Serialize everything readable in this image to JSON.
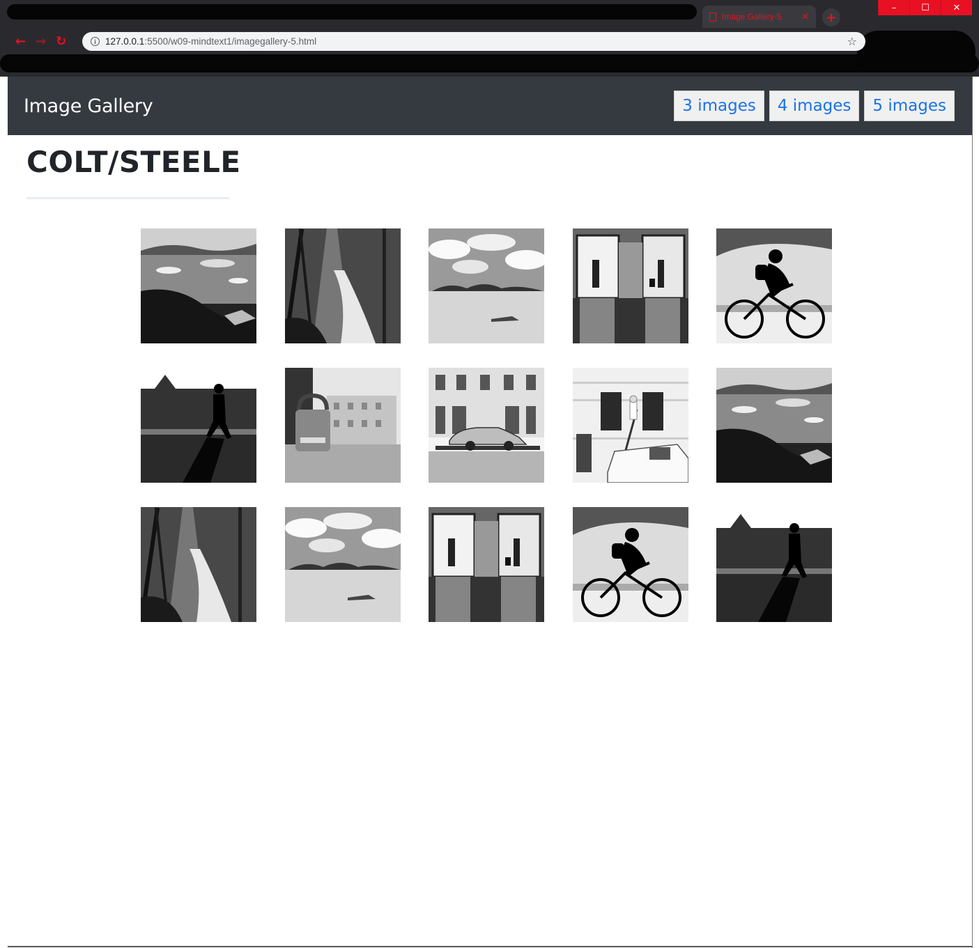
{
  "browser": {
    "tab_title": "Image Gallery-5",
    "tab_close": "✕",
    "new_tab": "+",
    "url_host": "127.0.0.1",
    "url_path": ":5500/w09-mindtext1/imagegallery-5.html",
    "window_controls": [
      "–",
      "☐",
      "✕"
    ]
  },
  "navbar": {
    "brand": "Image Gallery",
    "buttons": [
      "3 images",
      "4 images",
      "5 images"
    ]
  },
  "page": {
    "heading": "COLT/STEELE"
  },
  "gallery": {
    "images": [
      {
        "subject": "icebergs-lagoon"
      },
      {
        "subject": "forest-waterfall"
      },
      {
        "subject": "desert-clouds"
      },
      {
        "subject": "elevator-doors"
      },
      {
        "subject": "cyclist-silhouette"
      },
      {
        "subject": "walker-silhouette"
      },
      {
        "subject": "padlock-street"
      },
      {
        "subject": "car-on-trailer"
      },
      {
        "subject": "painter-ladder-van"
      },
      {
        "subject": "icebergs-lagoon"
      },
      {
        "subject": "forest-waterfall"
      },
      {
        "subject": "desert-clouds"
      },
      {
        "subject": "elevator-doors"
      },
      {
        "subject": "cyclist-silhouette"
      },
      {
        "subject": "walker-silhouette"
      }
    ]
  }
}
